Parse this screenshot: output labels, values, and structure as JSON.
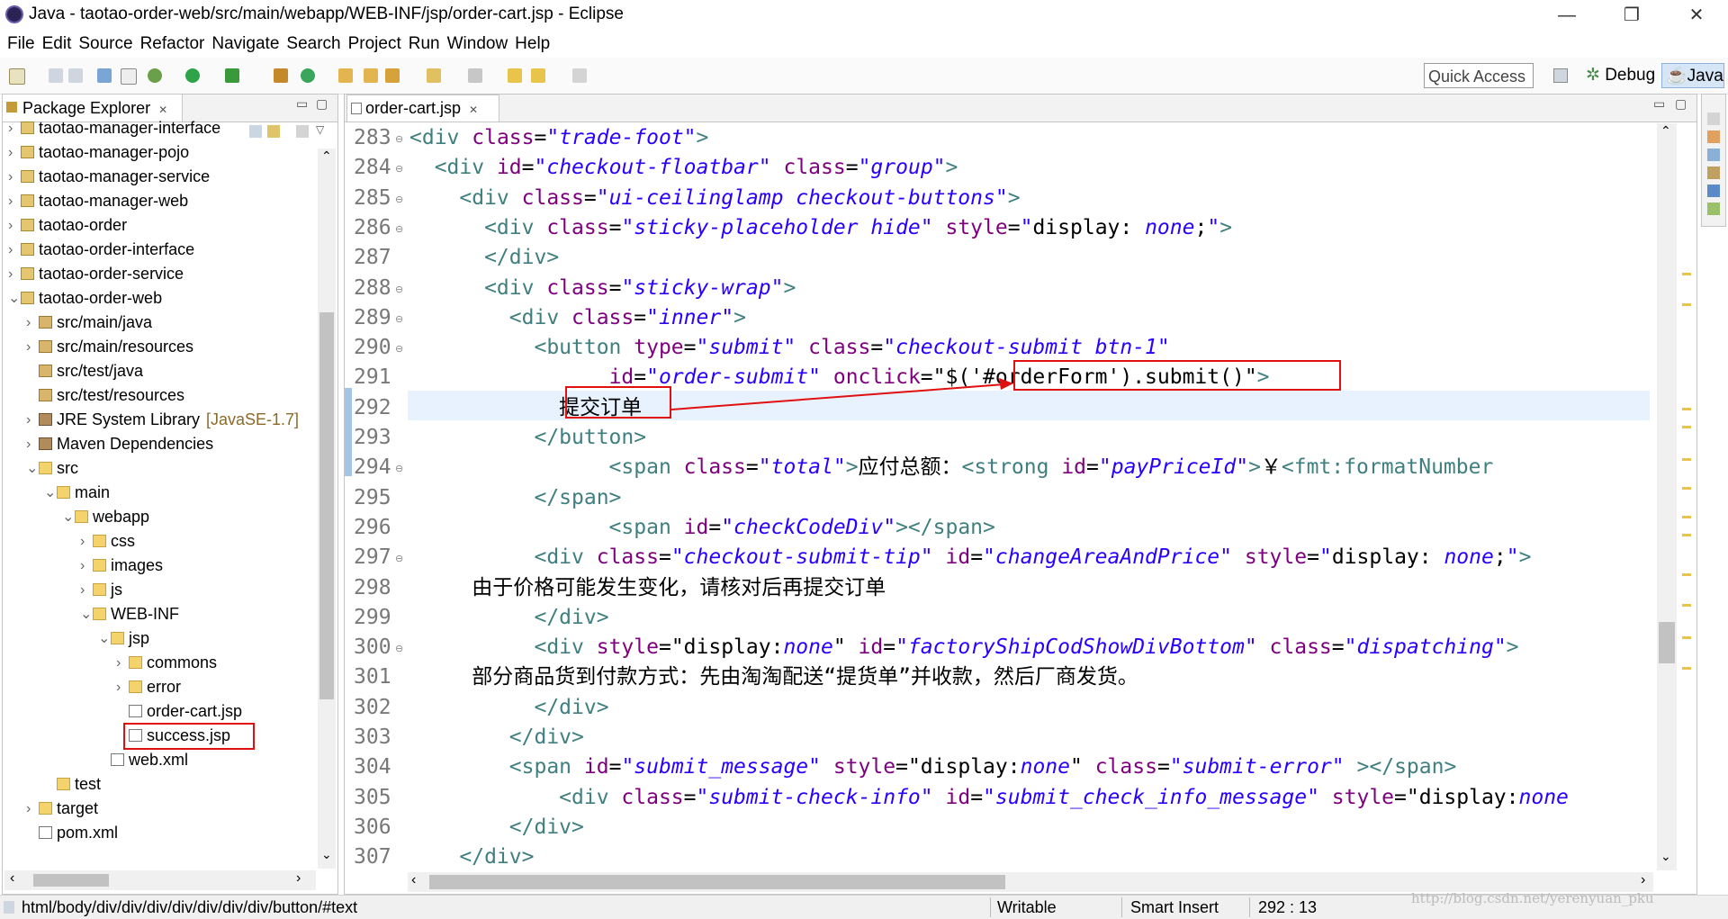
{
  "window": {
    "title": "Java - taotao-order-web/src/main/webapp/WEB-INF/jsp/order-cart.jsp - Eclipse",
    "minimize": "—",
    "maximize": "❐",
    "close": "✕"
  },
  "menu": [
    "File",
    "Edit",
    "Source",
    "Refactor",
    "Navigate",
    "Search",
    "Project",
    "Run",
    "Window",
    "Help"
  ],
  "toolbar": {
    "quick_access": "Quick Access",
    "perspective_debug": "Debug",
    "perspective_java": "Java"
  },
  "package_explorer": {
    "title": "Package Explorer",
    "items": [
      {
        "label": "taotao-manager-interface",
        "icon": "project-icon",
        "twisty": ">"
      },
      {
        "label": "taotao-manager-pojo",
        "icon": "project-icon",
        "twisty": ">"
      },
      {
        "label": "taotao-manager-service",
        "icon": "project-icon",
        "twisty": ">"
      },
      {
        "label": "taotao-manager-web",
        "icon": "project-icon",
        "twisty": ">"
      },
      {
        "label": "taotao-order",
        "icon": "project-icon",
        "twisty": ">"
      },
      {
        "label": "taotao-order-interface",
        "icon": "project-icon",
        "twisty": ">"
      },
      {
        "label": "taotao-order-service",
        "icon": "project-icon",
        "twisty": ">"
      },
      {
        "label": "taotao-order-web",
        "icon": "project-icon",
        "twisty": "v"
      },
      {
        "label": "src/main/java",
        "icon": "source-folder-icon",
        "twisty": ">"
      },
      {
        "label": "src/main/resources",
        "icon": "source-folder-icon",
        "twisty": ">"
      },
      {
        "label": "src/test/java",
        "icon": "source-folder-icon",
        "twisty": ""
      },
      {
        "label": "src/test/resources",
        "icon": "source-folder-icon",
        "twisty": ""
      },
      {
        "label": "JRE System Library",
        "suffix": "[JavaSE-1.7]",
        "icon": "library-icon",
        "twisty": ">"
      },
      {
        "label": "Maven Dependencies",
        "icon": "library-icon",
        "twisty": ">"
      },
      {
        "label": "src",
        "icon": "folder-icon",
        "twisty": "v"
      },
      {
        "label": "main",
        "icon": "folder-icon",
        "twisty": "v"
      },
      {
        "label": "webapp",
        "icon": "folder-icon",
        "twisty": "v"
      },
      {
        "label": "css",
        "icon": "folder-icon",
        "twisty": ">"
      },
      {
        "label": "images",
        "icon": "folder-icon",
        "twisty": ">"
      },
      {
        "label": "js",
        "icon": "folder-icon",
        "twisty": ">"
      },
      {
        "label": "WEB-INF",
        "icon": "folder-icon",
        "twisty": "v"
      },
      {
        "label": "jsp",
        "icon": "folder-icon",
        "twisty": "v"
      },
      {
        "label": "commons",
        "icon": "folder-icon",
        "twisty": ">"
      },
      {
        "label": "error",
        "icon": "folder-icon",
        "twisty": ">"
      },
      {
        "label": "order-cart.jsp",
        "icon": "jsp-file-icon",
        "twisty": ""
      },
      {
        "label": "success.jsp",
        "icon": "jsp-file-icon",
        "twisty": ""
      },
      {
        "label": "web.xml",
        "icon": "xml-file-icon",
        "twisty": ""
      },
      {
        "label": "test",
        "icon": "folder-icon",
        "twisty": ""
      },
      {
        "label": "target",
        "icon": "folder-icon",
        "twisty": ">"
      },
      {
        "label": "pom.xml",
        "icon": "xml-file-icon",
        "twisty": ""
      }
    ]
  },
  "editor": {
    "tab": "order-cart.jsp",
    "lines": [
      {
        "n": "283",
        "fold": true
      },
      {
        "n": "284",
        "fold": true
      },
      {
        "n": "285",
        "fold": true
      },
      {
        "n": "286",
        "fold": true
      },
      {
        "n": "287",
        "fold": false
      },
      {
        "n": "288",
        "fold": true
      },
      {
        "n": "289",
        "fold": true
      },
      {
        "n": "290",
        "fold": true
      },
      {
        "n": "291",
        "fold": false
      },
      {
        "n": "292",
        "fold": false
      },
      {
        "n": "293",
        "fold": false
      },
      {
        "n": "294",
        "fold": true
      },
      {
        "n": "295",
        "fold": false
      },
      {
        "n": "296",
        "fold": false
      },
      {
        "n": "297",
        "fold": true
      },
      {
        "n": "298",
        "fold": false
      },
      {
        "n": "299",
        "fold": false
      },
      {
        "n": "300",
        "fold": true
      },
      {
        "n": "301",
        "fold": false
      },
      {
        "n": "302",
        "fold": false
      },
      {
        "n": "303",
        "fold": false
      },
      {
        "n": "304",
        "fold": false
      },
      {
        "n": "305",
        "fold": false
      },
      {
        "n": "306",
        "fold": false
      },
      {
        "n": "307",
        "fold": false
      }
    ],
    "code": [
      [
        [
          "tag",
          "<div "
        ],
        [
          "attr",
          "class"
        ],
        [
          "plain",
          "="
        ],
        [
          "val",
          "\"trade-foot\""
        ],
        [
          "tag",
          ">"
        ]
      ],
      [
        [
          "tag",
          "  <div "
        ],
        [
          "attr",
          "id"
        ],
        [
          "plain",
          "="
        ],
        [
          "val",
          "\"checkout-floatbar\""
        ],
        [
          "plain",
          " "
        ],
        [
          "attr",
          "class"
        ],
        [
          "plain",
          "="
        ],
        [
          "val",
          "\"group\""
        ],
        [
          "tag",
          ">"
        ]
      ],
      [
        [
          "tag",
          "    <div "
        ],
        [
          "attr",
          "class"
        ],
        [
          "plain",
          "="
        ],
        [
          "val",
          "\"ui-ceilinglamp checkout-buttons\""
        ],
        [
          "tag",
          ">"
        ]
      ],
      [
        [
          "tag",
          "      <div "
        ],
        [
          "attr",
          "class"
        ],
        [
          "plain",
          "="
        ],
        [
          "val",
          "\"sticky-placeholder hide\""
        ],
        [
          "plain",
          " "
        ],
        [
          "attr",
          "style"
        ],
        [
          "plain",
          "="
        ],
        [
          "val",
          "\""
        ],
        [
          "plain",
          "display: "
        ],
        [
          "val",
          "none"
        ],
        [
          "plain",
          ";"
        ],
        [
          "val",
          "\""
        ],
        [
          "tag",
          ">"
        ]
      ],
      [
        [
          "tag",
          "      </div>"
        ]
      ],
      [
        [
          "tag",
          "      <div "
        ],
        [
          "attr",
          "class"
        ],
        [
          "plain",
          "="
        ],
        [
          "val",
          "\"sticky-wrap\""
        ],
        [
          "tag",
          ">"
        ]
      ],
      [
        [
          "tag",
          "        <div "
        ],
        [
          "attr",
          "class"
        ],
        [
          "plain",
          "="
        ],
        [
          "val",
          "\"inner\""
        ],
        [
          "tag",
          ">"
        ]
      ],
      [
        [
          "tag",
          "          <button "
        ],
        [
          "attr",
          "type"
        ],
        [
          "plain",
          "="
        ],
        [
          "val",
          "\"submit\""
        ],
        [
          "plain",
          " "
        ],
        [
          "attr",
          "class"
        ],
        [
          "plain",
          "="
        ],
        [
          "val",
          "\"checkout-submit btn-1\""
        ]
      ],
      [
        [
          "plain",
          "                "
        ],
        [
          "attr",
          "id"
        ],
        [
          "plain",
          "="
        ],
        [
          "val",
          "\"order-submit\""
        ],
        [
          "plain",
          " "
        ],
        [
          "attr",
          "onclick"
        ],
        [
          "plain",
          "=\"$('#orderForm').submit()\""
        ],
        [
          "tag",
          ">"
        ]
      ],
      [
        [
          "plain",
          "            提交订单"
        ]
      ],
      [
        [
          "tag",
          "          </button>"
        ]
      ],
      [
        [
          "tag",
          "                <span "
        ],
        [
          "attr",
          "class"
        ],
        [
          "plain",
          "="
        ],
        [
          "val",
          "\"total\""
        ],
        [
          "tag",
          ">"
        ],
        [
          "plain",
          "应付总额："
        ],
        [
          "tag",
          "<strong "
        ],
        [
          "attr",
          "id"
        ],
        [
          "plain",
          "="
        ],
        [
          "val",
          "\"payPriceId\""
        ],
        [
          "tag",
          ">"
        ],
        [
          "plain",
          "￥"
        ],
        [
          "tag",
          "<fmt:formatNumber"
        ]
      ],
      [
        [
          "tag",
          "          </span>"
        ]
      ],
      [
        [
          "tag",
          "                <span "
        ],
        [
          "attr",
          "id"
        ],
        [
          "plain",
          "="
        ],
        [
          "val",
          "\"checkCodeDiv\""
        ],
        [
          "tag",
          "></span>"
        ]
      ],
      [
        [
          "tag",
          "          <div "
        ],
        [
          "attr",
          "class"
        ],
        [
          "plain",
          "="
        ],
        [
          "val",
          "\"checkout-submit-tip\""
        ],
        [
          "plain",
          " "
        ],
        [
          "attr",
          "id"
        ],
        [
          "plain",
          "="
        ],
        [
          "val",
          "\"changeAreaAndPrice\""
        ],
        [
          "plain",
          " "
        ],
        [
          "attr",
          "style"
        ],
        [
          "plain",
          "="
        ],
        [
          "val",
          "\""
        ],
        [
          "plain",
          "display: "
        ],
        [
          "val",
          "none"
        ],
        [
          "plain",
          ";"
        ],
        [
          "val",
          "\""
        ],
        [
          "tag",
          ">"
        ]
      ],
      [
        [
          "plain",
          "     由于价格可能发生变化，请核对后再提交订单"
        ]
      ],
      [
        [
          "tag",
          "          </div>"
        ]
      ],
      [
        [
          "tag",
          "          <div "
        ],
        [
          "attr",
          "style"
        ],
        [
          "plain",
          "=\"display:"
        ],
        [
          "val",
          "none"
        ],
        [
          "plain",
          "\" "
        ],
        [
          "attr",
          "id"
        ],
        [
          "plain",
          "="
        ],
        [
          "val",
          "\"factoryShipCodShowDivBottom\""
        ],
        [
          "plain",
          " "
        ],
        [
          "attr",
          "class"
        ],
        [
          "plain",
          "="
        ],
        [
          "val",
          "\"dispatching\""
        ],
        [
          "tag",
          ">"
        ]
      ],
      [
        [
          "plain",
          "     部分商品货到付款方式：先由淘淘配送“提货单”并收款，然后厂商发货。"
        ]
      ],
      [
        [
          "tag",
          "          </div>"
        ]
      ],
      [
        [
          "tag",
          "        </div>"
        ]
      ],
      [
        [
          "tag",
          "        <span "
        ],
        [
          "attr",
          "id"
        ],
        [
          "plain",
          "="
        ],
        [
          "val",
          "\"submit_message\""
        ],
        [
          "plain",
          " "
        ],
        [
          "attr",
          "style"
        ],
        [
          "plain",
          "=\"display:"
        ],
        [
          "val",
          "none"
        ],
        [
          "plain",
          "\" "
        ],
        [
          "attr",
          "class"
        ],
        [
          "plain",
          "="
        ],
        [
          "val",
          "\"submit-error\""
        ],
        [
          "plain",
          " "
        ],
        [
          "tag",
          "></span>"
        ]
      ],
      [
        [
          "tag",
          "            <div "
        ],
        [
          "attr",
          "class"
        ],
        [
          "plain",
          "="
        ],
        [
          "val",
          "\"submit-check-info\""
        ],
        [
          "plain",
          " "
        ],
        [
          "attr",
          "id"
        ],
        [
          "plain",
          "="
        ],
        [
          "val",
          "\"submit_check_info_message\""
        ],
        [
          "plain",
          " "
        ],
        [
          "attr",
          "style"
        ],
        [
          "plain",
          "=\"display:"
        ],
        [
          "val",
          "none"
        ]
      ],
      [
        [
          "tag",
          "        </div>"
        ]
      ],
      [
        [
          "tag",
          "    </div>"
        ]
      ]
    ]
  },
  "status": {
    "path": "html/body/div/div/div/div/div/div/div/button/#text",
    "writable": "Writable",
    "insert_mode": "Smart Insert",
    "position": "292 : 13"
  },
  "watermark": "http://blog.csdn.net/yerenyuan_pku",
  "colors": {
    "tag": "#3f7f7f",
    "attribute": "#7f007f",
    "value": "#2a00ff",
    "annotation": "#e01010",
    "current_line": "#e8f2fe"
  }
}
